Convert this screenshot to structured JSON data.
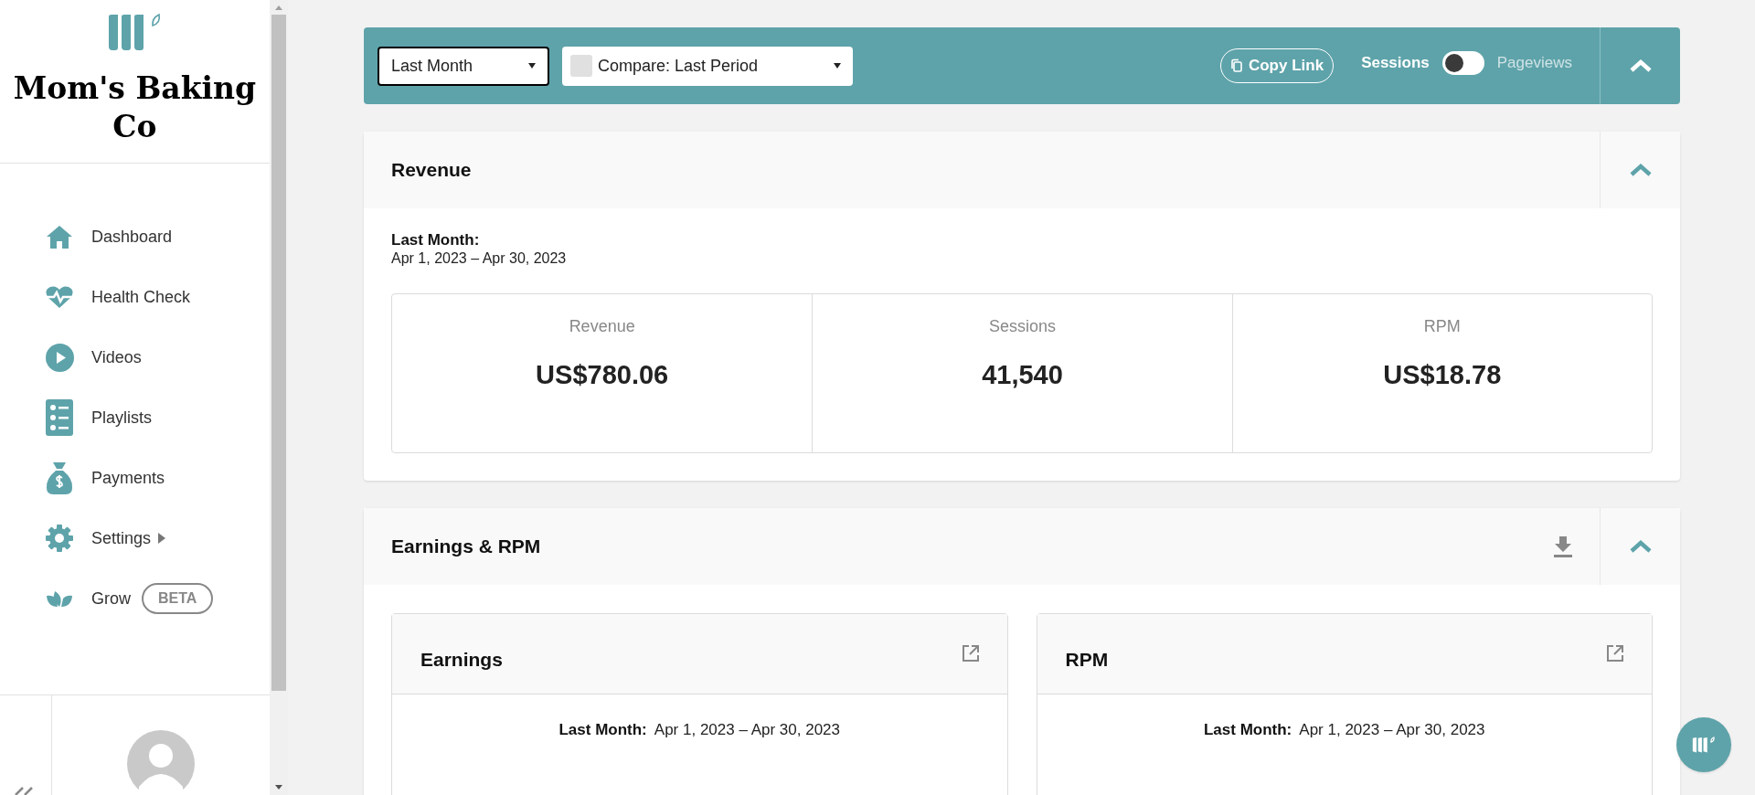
{
  "sidebar": {
    "brand": "Mom's Baking Co",
    "nav": [
      {
        "kind": "home",
        "label": "Dashboard"
      },
      {
        "kind": "heart",
        "label": "Health Check"
      },
      {
        "kind": "play",
        "label": "Videos"
      },
      {
        "kind": "list",
        "label": "Playlists"
      },
      {
        "kind": "moneybag",
        "label": "Payments"
      },
      {
        "kind": "gear",
        "label": "Settings",
        "submenu": true
      },
      {
        "kind": "leaf",
        "label": "Grow",
        "badge": "BETA"
      }
    ]
  },
  "filter_bar": {
    "period": "Last Month",
    "compare": "Compare: Last Period",
    "compare_checked": false,
    "copy_link": "Copy Link",
    "metric_toggle": [
      {
        "label": "Sessions",
        "selected": true
      },
      {
        "label": "Pageviews",
        "selected": false
      }
    ]
  },
  "revenue": {
    "title": "Revenue",
    "period_label": "Last Month:",
    "date_range": "Apr 1, 2023 – Apr 30, 2023",
    "stats": [
      {
        "label": "Revenue",
        "value": "US$780.06"
      },
      {
        "label": "Sessions",
        "value": "41,540"
      },
      {
        "label": "RPM",
        "value": "US$18.78"
      }
    ]
  },
  "earnings_rpm": {
    "title": "Earnings & RPM",
    "panels": [
      {
        "title": "Earnings",
        "period_label": "Last Month:",
        "date_range": "Apr 1, 2023 – Apr 30, 2023"
      },
      {
        "title": "RPM",
        "period_label": "Last Month:",
        "date_range": "Apr 1, 2023 – Apr 30, 2023"
      }
    ]
  }
}
